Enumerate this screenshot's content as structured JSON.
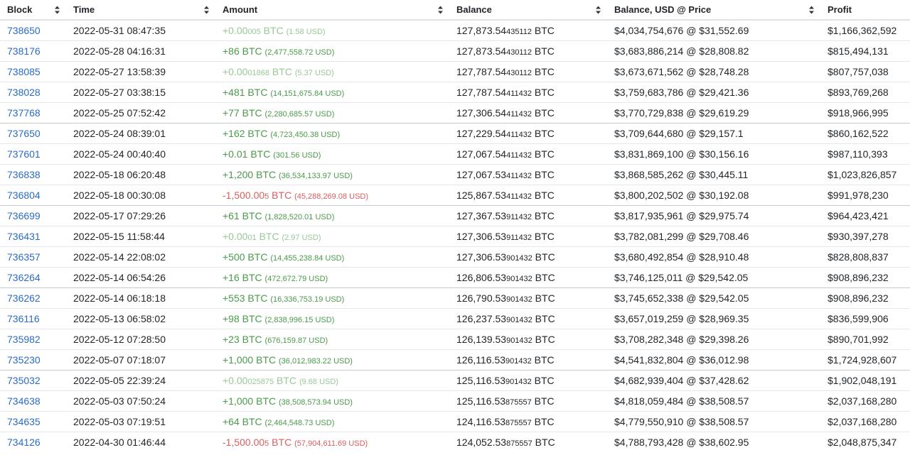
{
  "headers": {
    "block": "Block",
    "time": "Time",
    "amount": "Amount",
    "balance": "Balance",
    "balance_usd": "Balance, USD @ Price",
    "profit": "Profit"
  },
  "colors": {
    "link": "#2a6cc4",
    "positive": "#4a9a4a",
    "negative": "#d95e5e",
    "faint": "#98c898"
  },
  "rows": [
    {
      "block": "738650",
      "time": "2022-05-31 08:47:35",
      "amt_main": "+0.00",
      "amt_sub": "005",
      "amt_unit": " BTC ",
      "amt_usd": "(1.58 USD)",
      "kind": "faint",
      "bal_main": "127,873.54",
      "bal_sub": "435112",
      "bal_unit": " BTC",
      "bal_usd": "$4,034,754,676 @ $31,552.69",
      "profit": "$1,166,362,592",
      "group": false
    },
    {
      "block": "738176",
      "time": "2022-05-28 04:16:31",
      "amt_main": "+86",
      "amt_sub": "",
      "amt_unit": " BTC ",
      "amt_usd": "(2,477,558.72 USD)",
      "kind": "pos",
      "bal_main": "127,873.54",
      "bal_sub": "430112",
      "bal_unit": " BTC",
      "bal_usd": "$3,683,886,214 @ $28,808.82",
      "profit": "$815,494,131",
      "group": false
    },
    {
      "block": "738085",
      "time": "2022-05-27 13:58:39",
      "amt_main": "+0.00",
      "amt_sub": "01868",
      "amt_unit": " BTC ",
      "amt_usd": "(5.37 USD)",
      "kind": "faint",
      "bal_main": "127,787.54",
      "bal_sub": "430112",
      "bal_unit": " BTC",
      "bal_usd": "$3,673,671,562 @ $28,748.28",
      "profit": "$807,757,038",
      "group": false
    },
    {
      "block": "738028",
      "time": "2022-05-27 03:38:15",
      "amt_main": "+481",
      "amt_sub": "",
      "amt_unit": " BTC ",
      "amt_usd": "(14,151,675.84 USD)",
      "kind": "pos",
      "bal_main": "127,787.54",
      "bal_sub": "411432",
      "bal_unit": " BTC",
      "bal_usd": "$3,759,683,786 @ $29,421.36",
      "profit": "$893,769,268",
      "group": false
    },
    {
      "block": "737768",
      "time": "2022-05-25 07:52:42",
      "amt_main": "+77",
      "amt_sub": "",
      "amt_unit": " BTC ",
      "amt_usd": "(2,280,685.57 USD)",
      "kind": "pos",
      "bal_main": "127,306.54",
      "bal_sub": "411432",
      "bal_unit": " BTC",
      "bal_usd": "$3,770,729,838 @ $29,619.29",
      "profit": "$918,966,995",
      "group": false
    },
    {
      "block": "737650",
      "time": "2022-05-24 08:39:01",
      "amt_main": "+162",
      "amt_sub": "",
      "amt_unit": " BTC ",
      "amt_usd": "(4,723,450.38 USD)",
      "kind": "pos",
      "bal_main": "127,229.54",
      "bal_sub": "411432",
      "bal_unit": " BTC",
      "bal_usd": "$3,709,644,680 @ $29,157.1",
      "profit": "$860,162,522",
      "group": true
    },
    {
      "block": "737601",
      "time": "2022-05-24 00:40:40",
      "amt_main": "+0.01",
      "amt_sub": "",
      "amt_unit": " BTC ",
      "amt_usd": "(301.56 USD)",
      "kind": "pos",
      "bal_main": "127,067.54",
      "bal_sub": "411432",
      "bal_unit": " BTC",
      "bal_usd": "$3,831,869,100 @ $30,156.16",
      "profit": "$987,110,393",
      "group": false
    },
    {
      "block": "736838",
      "time": "2022-05-18 06:20:48",
      "amt_main": "+1,200",
      "amt_sub": "",
      "amt_unit": " BTC ",
      "amt_usd": "(36,534,133.97 USD)",
      "kind": "pos",
      "bal_main": "127,067.53",
      "bal_sub": "411432",
      "bal_unit": " BTC",
      "bal_usd": "$3,868,585,262 @ $30,445.11",
      "profit": "$1,023,826,857",
      "group": false
    },
    {
      "block": "736804",
      "time": "2022-05-18 00:30:08",
      "amt_main": "-1,500.00",
      "amt_sub": "5",
      "amt_unit": " BTC ",
      "amt_usd": "(45,288,269.08 USD)",
      "kind": "neg",
      "bal_main": "125,867.53",
      "bal_sub": "411432",
      "bal_unit": " BTC",
      "bal_usd": "$3,800,202,502 @ $30,192.08",
      "profit": "$991,978,230",
      "group": false
    },
    {
      "block": "736699",
      "time": "2022-05-17 07:29:26",
      "amt_main": "+61",
      "amt_sub": "",
      "amt_unit": " BTC ",
      "amt_usd": "(1,828,520.01 USD)",
      "kind": "pos",
      "bal_main": "127,367.53",
      "bal_sub": "911432",
      "bal_unit": " BTC",
      "bal_usd": "$3,817,935,961 @ $29,975.74",
      "profit": "$964,423,421",
      "group": true
    },
    {
      "block": "736431",
      "time": "2022-05-15 11:58:44",
      "amt_main": "+0.00",
      "amt_sub": "01",
      "amt_unit": " BTC ",
      "amt_usd": "(2.97 USD)",
      "kind": "faint",
      "bal_main": "127,306.53",
      "bal_sub": "911432",
      "bal_unit": " BTC",
      "bal_usd": "$3,782,081,299 @ $29,708.46",
      "profit": "$930,397,278",
      "group": false
    },
    {
      "block": "736357",
      "time": "2022-05-14 22:08:02",
      "amt_main": "+500",
      "amt_sub": "",
      "amt_unit": " BTC ",
      "amt_usd": "(14,455,238.84 USD)",
      "kind": "pos",
      "bal_main": "127,306.53",
      "bal_sub": "901432",
      "bal_unit": " BTC",
      "bal_usd": "$3,680,492,854 @ $28,910.48",
      "profit": "$828,808,837",
      "group": false
    },
    {
      "block": "736264",
      "time": "2022-05-14 06:54:26",
      "amt_main": "+16",
      "amt_sub": "",
      "amt_unit": " BTC ",
      "amt_usd": "(472,672.79 USD)",
      "kind": "pos",
      "bal_main": "126,806.53",
      "bal_sub": "901432",
      "bal_unit": " BTC",
      "bal_usd": "$3,746,125,011 @ $29,542.05",
      "profit": "$908,896,232",
      "group": false
    },
    {
      "block": "736262",
      "time": "2022-05-14 06:18:18",
      "amt_main": "+553",
      "amt_sub": "",
      "amt_unit": " BTC ",
      "amt_usd": "(16,336,753.19 USD)",
      "kind": "pos",
      "bal_main": "126,790.53",
      "bal_sub": "901432",
      "bal_unit": " BTC",
      "bal_usd": "$3,745,652,338 @ $29,542.05",
      "profit": "$908,896,232",
      "group": true
    },
    {
      "block": "736116",
      "time": "2022-05-13 06:58:02",
      "amt_main": "+98",
      "amt_sub": "",
      "amt_unit": " BTC ",
      "amt_usd": "(2,838,996.15 USD)",
      "kind": "pos",
      "bal_main": "126,237.53",
      "bal_sub": "901432",
      "bal_unit": " BTC",
      "bal_usd": "$3,657,019,259 @ $28,969.35",
      "profit": "$836,599,906",
      "group": false
    },
    {
      "block": "735982",
      "time": "2022-05-12 07:28:50",
      "amt_main": "+23",
      "amt_sub": "",
      "amt_unit": " BTC ",
      "amt_usd": "(676,159.87 USD)",
      "kind": "pos",
      "bal_main": "126,139.53",
      "bal_sub": "901432",
      "bal_unit": " BTC",
      "bal_usd": "$3,708,282,348 @ $29,398.26",
      "profit": "$890,701,992",
      "group": false
    },
    {
      "block": "735230",
      "time": "2022-05-07 07:18:07",
      "amt_main": "+1,000",
      "amt_sub": "",
      "amt_unit": " BTC ",
      "amt_usd": "(36,012,983.22 USD)",
      "kind": "pos",
      "bal_main": "126,116.53",
      "bal_sub": "901432",
      "bal_unit": " BTC",
      "bal_usd": "$4,541,832,804 @ $36,012.98",
      "profit": "$1,724,928,607",
      "group": false
    },
    {
      "block": "735032",
      "time": "2022-05-05 22:39:24",
      "amt_main": "+0.00",
      "amt_sub": "025875",
      "amt_unit": " BTC ",
      "amt_usd": "(9.68 USD)",
      "kind": "faint",
      "bal_main": "125,116.53",
      "bal_sub": "901432",
      "bal_unit": " BTC",
      "bal_usd": "$4,682,939,404 @ $37,428.62",
      "profit": "$1,902,048,191",
      "group": true
    },
    {
      "block": "734638",
      "time": "2022-05-03 07:50:24",
      "amt_main": "+1,000",
      "amt_sub": "",
      "amt_unit": " BTC ",
      "amt_usd": "(38,508,573.94 USD)",
      "kind": "pos",
      "bal_main": "125,116.53",
      "bal_sub": "875557",
      "bal_unit": " BTC",
      "bal_usd": "$4,818,059,484 @ $38,508.57",
      "profit": "$2,037,168,280",
      "group": false
    },
    {
      "block": "734635",
      "time": "2022-05-03 07:19:51",
      "amt_main": "+64",
      "amt_sub": "",
      "amt_unit": " BTC ",
      "amt_usd": "(2,464,548.73 USD)",
      "kind": "pos",
      "bal_main": "124,116.53",
      "bal_sub": "875557",
      "bal_unit": " BTC",
      "bal_usd": "$4,779,550,910 @ $38,508.57",
      "profit": "$2,037,168,280",
      "group": false
    },
    {
      "block": "734126",
      "time": "2022-04-30 01:46:44",
      "amt_main": "-1,500.00",
      "amt_sub": "5",
      "amt_unit": " BTC ",
      "amt_usd": "(57,904,611.69 USD)",
      "kind": "neg",
      "bal_main": "124,052.53",
      "bal_sub": "875557",
      "bal_unit": " BTC",
      "bal_usd": "$4,788,793,428 @ $38,602.95",
      "profit": "$2,048,875,347",
      "group": false
    }
  ]
}
